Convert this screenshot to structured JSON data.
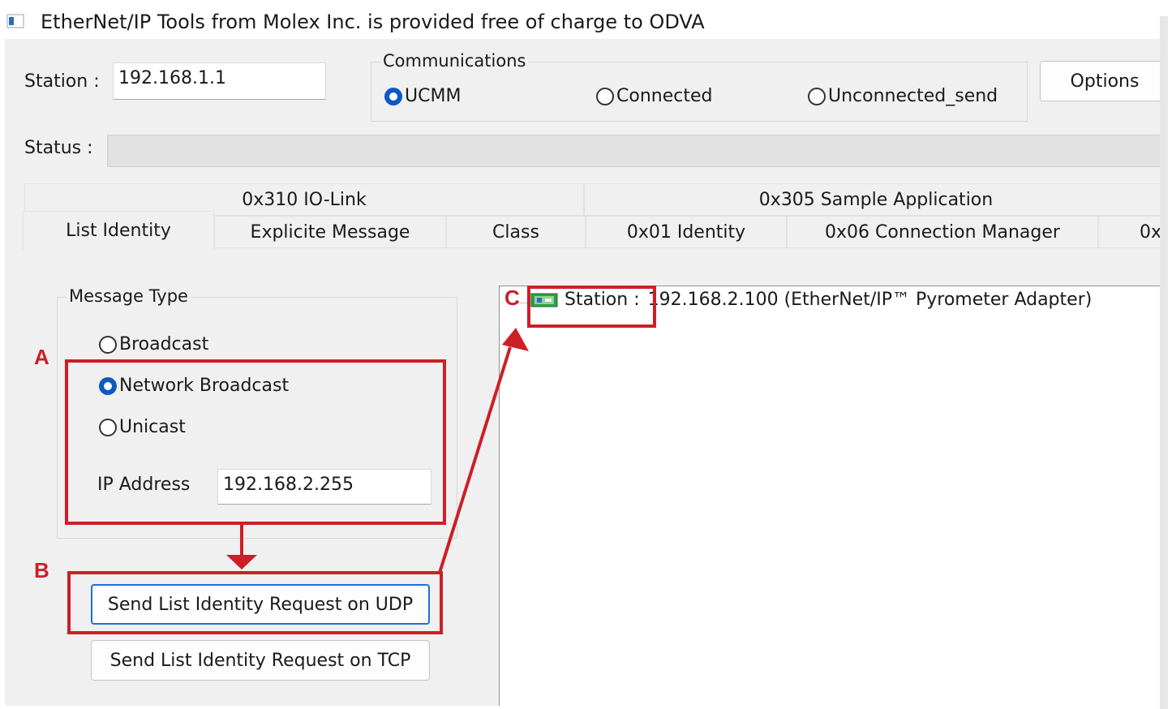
{
  "window": {
    "title": "EtherNet/IP Tools from Molex Inc. is provided free of charge to ODVA"
  },
  "station": {
    "label": "Station :",
    "value": "192.168.1.1"
  },
  "communications": {
    "legend": "Communications",
    "options": [
      {
        "label": "UCMM",
        "selected": true
      },
      {
        "label": "Connected",
        "selected": false
      },
      {
        "label": "Unconnected_send",
        "selected": false
      }
    ]
  },
  "options_button": "Options",
  "status": {
    "label": "Status :"
  },
  "tabs": {
    "row_top": [
      "0x310 IO-Link",
      "0x305 Sample Application"
    ],
    "row_bottom": [
      "List Identity",
      "Explicite Message",
      "Class",
      "0x01 Identity",
      "0x06 Connection Manager",
      "0x"
    ],
    "active": "List Identity"
  },
  "message_type": {
    "legend": "Message Type",
    "options": [
      {
        "label": "Broadcast",
        "selected": false
      },
      {
        "label": "Network Broadcast",
        "selected": true
      },
      {
        "label": "Unicast",
        "selected": false
      }
    ],
    "ip_label": "IP Address",
    "ip_value": "192.168.2.255"
  },
  "buttons": {
    "udp": "Send List Identity Request on UDP",
    "tcp": "Send List Identity Request on TCP"
  },
  "tree": {
    "station_label": "Station :",
    "station_text": "192.168.2.100 (EtherNet/IP™ Pyrometer Adapter)"
  },
  "annotations": {
    "a": "A",
    "b": "B",
    "c": "C",
    "color": "#cc1f27"
  },
  "colors": {
    "accent": "#0a5ac2",
    "window_bg": "#f0f0f0"
  }
}
